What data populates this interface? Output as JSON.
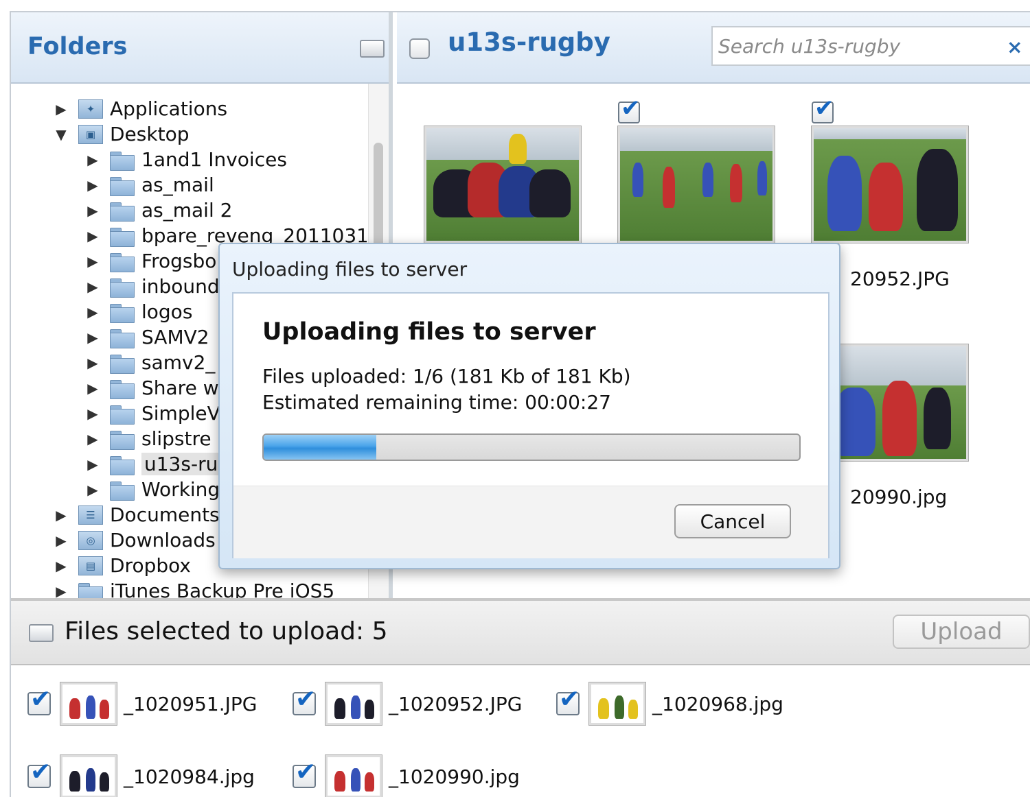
{
  "folders_panel": {
    "title": "Folders",
    "tree": [
      {
        "label": "Applications",
        "level": 0,
        "expanded": false,
        "icon": "applications-icon"
      },
      {
        "label": "Desktop",
        "level": 0,
        "expanded": true,
        "icon": "desktop-icon"
      },
      {
        "label": "1and1 Invoices",
        "level": 1,
        "expanded": false,
        "icon": "folder-icon"
      },
      {
        "label": "as_mail",
        "level": 1,
        "expanded": false,
        "icon": "folder-icon"
      },
      {
        "label": "as_mail 2",
        "level": 1,
        "expanded": false,
        "icon": "folder-icon"
      },
      {
        "label": "bpare_reveng_2011031",
        "level": 1,
        "expanded": false,
        "icon": "folder-icon"
      },
      {
        "label": "Frogsbo",
        "level": 1,
        "expanded": false,
        "icon": "folder-icon"
      },
      {
        "label": "inbound",
        "level": 1,
        "expanded": false,
        "icon": "folder-icon"
      },
      {
        "label": "logos",
        "level": 1,
        "expanded": false,
        "icon": "folder-icon"
      },
      {
        "label": "SAMV2",
        "level": 1,
        "expanded": false,
        "icon": "folder-icon"
      },
      {
        "label": "samv2_",
        "level": 1,
        "expanded": false,
        "icon": "folder-icon"
      },
      {
        "label": "Share w",
        "level": 1,
        "expanded": false,
        "icon": "folder-icon"
      },
      {
        "label": "SimpleV",
        "level": 1,
        "expanded": false,
        "icon": "folder-icon"
      },
      {
        "label": "slipstre",
        "level": 1,
        "expanded": false,
        "icon": "folder-icon"
      },
      {
        "label": "u13s-ru",
        "level": 1,
        "expanded": false,
        "icon": "folder-icon",
        "selected": true
      },
      {
        "label": "Working",
        "level": 1,
        "expanded": false,
        "icon": "folder-icon"
      },
      {
        "label": "Documents",
        "level": 0,
        "expanded": false,
        "icon": "documents-icon"
      },
      {
        "label": "Downloads",
        "level": 0,
        "expanded": false,
        "icon": "downloads-icon"
      },
      {
        "label": "Dropbox",
        "level": 0,
        "expanded": false,
        "icon": "dropbox-icon"
      },
      {
        "label": "iTunes Backup Pre iOS5",
        "level": 0,
        "expanded": false,
        "icon": "folder-icon"
      }
    ]
  },
  "content_panel": {
    "folder_title": "u13s-rugby",
    "search_placeholder": "Search u13s-rugby",
    "clear_symbol": "×",
    "thumbnails": [
      {
        "name": "",
        "checked": false
      },
      {
        "name": "",
        "checked": true
      },
      {
        "name": "20952.JPG",
        "checked": true
      },
      {
        "name": "20990.jpg",
        "checked": false
      }
    ]
  },
  "upload_bar": {
    "label": "Files selected to upload: 5",
    "upload_label": "Upload"
  },
  "queue": [
    {
      "name": "_1020951.JPG",
      "checked": true
    },
    {
      "name": "_1020952.JPG",
      "checked": true
    },
    {
      "name": "_1020968.jpg",
      "checked": true
    },
    {
      "name": "_1020984.jpg",
      "checked": true
    },
    {
      "name": "_1020990.jpg",
      "checked": true
    }
  ],
  "modal": {
    "window_title": "Uploading files to server",
    "heading": "Uploading files to server",
    "files_uploaded": "Files uploaded: 1/6 (181 Kb of 181 Kb)",
    "remaining_time": "Estimated remaining time: 00:00:27",
    "progress": 0.21,
    "cancel_label": "Cancel"
  },
  "colors": {
    "accent": "#2a6bb0",
    "check": "#1565c0"
  },
  "icons": {
    "collapse": "panel-toggle-icon",
    "arrow_collapsed": "▶",
    "arrow_expanded": "▼",
    "check": "✔"
  }
}
